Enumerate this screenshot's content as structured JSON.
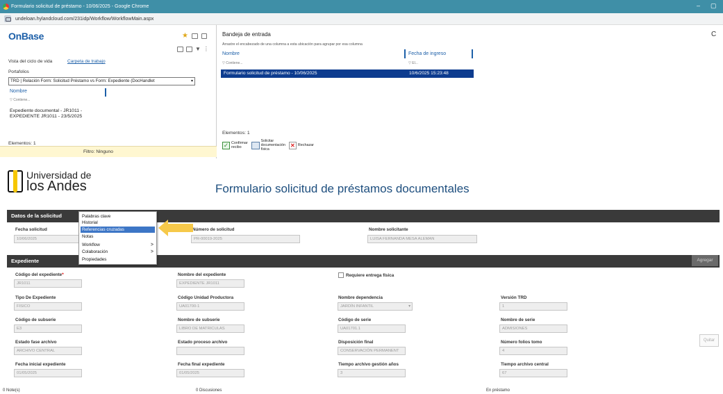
{
  "browser": {
    "title": "Formulario solicitud de préstamo - 10/06/2025 - Google Chrome",
    "url": "undeloan.hylandcloud.com/231idp/Workflow/WorkflowMain.aspx",
    "min": "–",
    "max": "▢"
  },
  "onbase": {
    "logo": "OnBase",
    "left": {
      "tab_lifecycle": "Vista del ciclo de vida",
      "tab_folder": "Carpeta de trabajo",
      "portfolios_label": "Portafolios",
      "portfolio_selected": "TRD | Relación Form: Solicitud Préstamo vs Form: Expediente (DocHandlet",
      "col_name": "Nombre",
      "filter_contains": "Contiene...",
      "item_line1": "Expediente documental - JR1011 -",
      "item_line2": "EXPEDIENTE JR1011 - 23/5/2025",
      "elements": "Elementos: 1",
      "filter_status": "Filtro: Ninguno"
    },
    "right": {
      "title": "Bandeja de entrada",
      "hint": "Arrastre el encabezado de una columna a esta ubicación para agrupar por esa columna",
      "col_name": "Nombre",
      "col_date": "Fecha de ingreso",
      "filter_contains": "Contiene...",
      "filter_date": "El...",
      "row_name": "Formulario solicitud de préstamo - 10/06/2025",
      "row_date": "10/6/2025 15:23:48",
      "elements": "Elementos: 1",
      "btn_confirm_1": "Confirmar",
      "btn_confirm_2": "recibo",
      "btn_request_1": "Solicitar",
      "btn_request_2": "documentación",
      "btn_request_3": "física",
      "btn_reject": "Rechazar",
      "refresh": "C"
    }
  },
  "form": {
    "uni_1": "Universidad de",
    "uni_2": "los Andes",
    "title": "Formulario solicitud de préstamos documentales",
    "sec_request": "Datos de la solicitud",
    "sec_file": "Expediente",
    "btn_add": "Agregar",
    "btn_remove": "Quitar",
    "lbl_fecha": "Fecha solicitud",
    "val_fecha": "10/06/2025",
    "lbl_num": "Número de solicitud",
    "val_num": "PR-00019-2025",
    "lbl_sol": "Nombre solicitante",
    "val_sol": "LUISA FERNANDA MESA ALEMAN",
    "lbl_cod_exp": "Código del expediente",
    "req": "*",
    "val_cod_exp": "JR1011",
    "lbl_nom_exp": "Nombre del expediente",
    "val_nom_exp": "EXPEDIENTE JR1011",
    "lbl_entrega": "Requiere entrega física",
    "lbl_tipo": "Tipo De Expediente",
    "val_tipo": "FISICO",
    "lbl_cod_uni": "Código Unidad Productora",
    "val_cod_uni": "UA01700-1",
    "lbl_dep": "Nombre dependencia",
    "val_dep": "JARDÍN INFANTIL",
    "lbl_trd": "Versión TRD",
    "val_trd": "1",
    "lbl_cod_sub": "Código de subserie",
    "val_cod_sub": "E3",
    "lbl_nom_sub": "Nombre de subserie",
    "val_nom_sub": "LIBRO DE MATRICULAS",
    "lbl_cod_ser": "Código de serie",
    "val_cod_ser": "UA01701.1",
    "lbl_nom_ser": "Nombre de serie",
    "val_nom_ser": "ADMISIONES",
    "lbl_fase": "Estado fase archivo",
    "val_fase": "ARCHIVO CENTRAL",
    "lbl_proc": "Estado proceso archivo",
    "val_proc": "",
    "lbl_disp": "Disposición final",
    "val_disp": "CONSERVACIÓN PERMANENT",
    "lbl_folios": "Número folios tomo",
    "val_folios": "4",
    "lbl_fini": "Fecha inicial expediente",
    "val_fini": "01/05/2025",
    "lbl_ffin": "Fecha final expediente",
    "val_ffin": "01/05/2025",
    "lbl_tgest": "Tiempo archivo gestión años",
    "val_tgest": "3",
    "lbl_tcent": "Tiempo archivo central",
    "val_tcent": "67"
  },
  "context_menu": {
    "items": [
      "Palabras clave",
      "Historial",
      "Referencias cruzadas",
      "Notas",
      "Workflow",
      "Colaboración",
      "Propiedades"
    ],
    "submenu_arrow": ">"
  },
  "status": {
    "notes": "0 Note(s)",
    "discussions": "0 Discusiones",
    "state": "En préstamo"
  },
  "colors": {
    "accent": "#1c5fa8",
    "selected_row": "#0d3c8f",
    "highlight_arrow": "#f6c94a"
  }
}
